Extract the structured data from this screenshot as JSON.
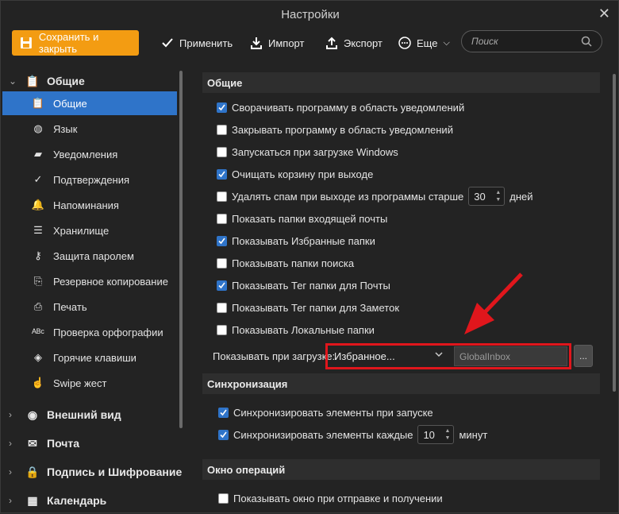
{
  "window": {
    "title": "Настройки"
  },
  "toolbar": {
    "save": "Сохранить и закрыть",
    "apply": "Применить",
    "import": "Импорт",
    "export": "Экспорт",
    "more": "Еще",
    "search_placeholder": "Поиск"
  },
  "sidebar": {
    "group_general": "Общие",
    "items": [
      {
        "label": "Общие",
        "icon": "clipboard-icon",
        "active": true
      },
      {
        "label": "Язык",
        "icon": "globe-icon"
      },
      {
        "label": "Уведомления",
        "icon": "chat-bubble-icon"
      },
      {
        "label": "Подтверждения",
        "icon": "check-circle-icon"
      },
      {
        "label": "Напоминания",
        "icon": "bell-icon"
      },
      {
        "label": "Хранилище",
        "icon": "storage-icon"
      },
      {
        "label": "Защита паролем",
        "icon": "key-icon"
      },
      {
        "label": "Резервное копирование",
        "icon": "backup-icon"
      },
      {
        "label": "Печать",
        "icon": "printer-icon"
      },
      {
        "label": "Проверка орфографии",
        "icon": "spellcheck-icon"
      },
      {
        "label": "Горячие клавиши",
        "icon": "hotkeys-icon"
      },
      {
        "label": "Swipe жест",
        "icon": "hand-icon"
      }
    ],
    "groups": [
      {
        "label": "Внешний вид",
        "icon": "palette-icon"
      },
      {
        "label": "Почта",
        "icon": "envelope-icon"
      },
      {
        "label": "Подпись и Шифрование",
        "icon": "lock-icon"
      },
      {
        "label": "Календарь",
        "icon": "calendar-icon"
      }
    ]
  },
  "general": {
    "header": "Общие",
    "options": [
      {
        "label": "Сворачивать программу в область уведомлений",
        "checked": true
      },
      {
        "label": "Закрывать программу в область уведомлений",
        "checked": false
      },
      {
        "label": "Запускаться при загрузке Windows",
        "checked": false
      },
      {
        "label": "Очищать корзину при выходе",
        "checked": true
      },
      {
        "label": "Удалять спам при выходе из программы старше",
        "checked": false,
        "spin": "30",
        "suffix": "дней"
      },
      {
        "label": "Показать папки входящей почты",
        "checked": false
      },
      {
        "label": "Показывать Избранные папки",
        "checked": true
      },
      {
        "label": "Показывать папки поиска",
        "checked": false
      },
      {
        "label": "Показывать Тег папки для Почты",
        "checked": true
      },
      {
        "label": "Показывать Тег папки для Заметок",
        "checked": false
      },
      {
        "label": "Показывать Локальные папки",
        "checked": false
      }
    ],
    "startup_label": "Показывать при загрузке:",
    "startup_select": "Избранное...",
    "startup_field": "GlobalInbox",
    "browse": "..."
  },
  "sync": {
    "header": "Синхронизация",
    "on_start": "Синхронизировать элементы при запуске",
    "every": "Синхронизировать элементы каждые",
    "every_value": "10",
    "every_unit": "минут"
  },
  "ops": {
    "header": "Окно операций",
    "show": "Показывать окно при отправке и получении"
  },
  "colors": {
    "accent": "#2f74c9",
    "save": "#f39c12",
    "highlight": "#e0161c"
  }
}
